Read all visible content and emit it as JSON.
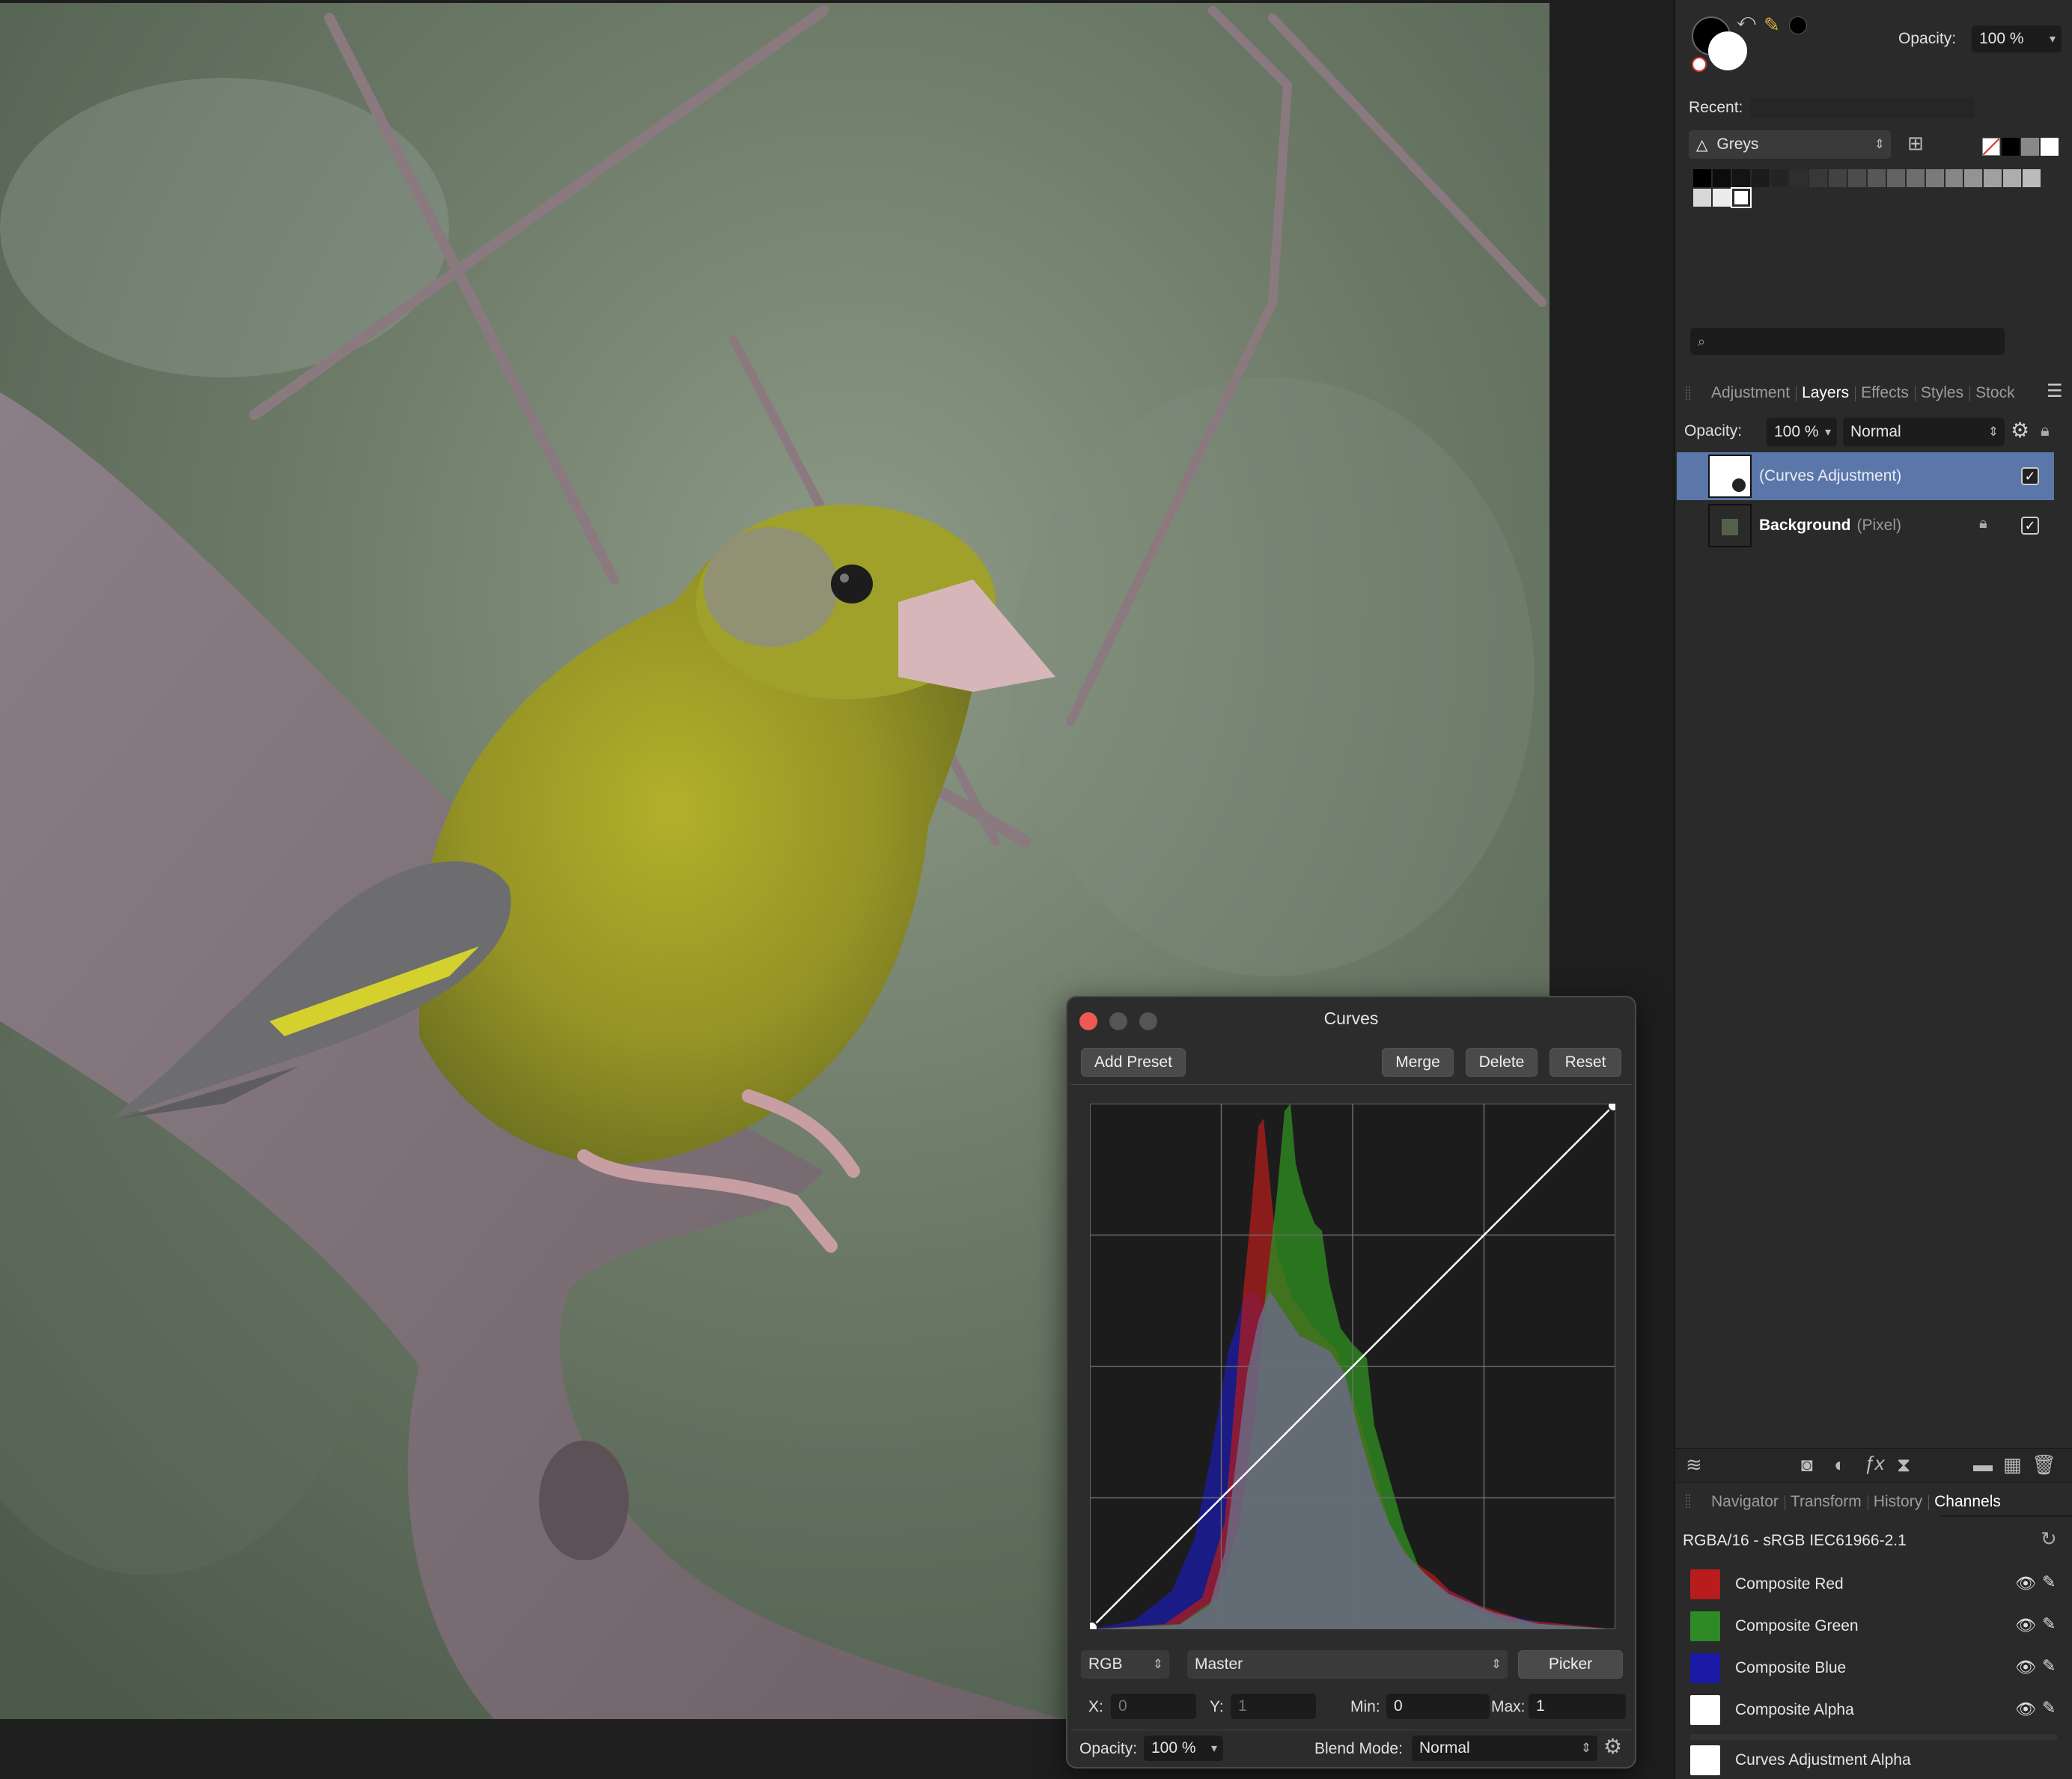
{
  "color_panel": {
    "opacity_label": "Opacity:",
    "opacity_value": "100 %",
    "recent_label": "Recent:",
    "palette_name": "Greys",
    "search_placeholder": ""
  },
  "layers_panel": {
    "tabs": [
      "Adjustment",
      "Layers",
      "Effects",
      "Styles",
      "Stock"
    ],
    "active_tab": "Layers",
    "opacity_label": "Opacity:",
    "opacity_value": "100 %",
    "blend_mode": "Normal",
    "layers": [
      {
        "name": "(Curves Adjustment)",
        "type": "",
        "selected": true,
        "visible": true,
        "locked": false
      },
      {
        "name": "Background",
        "type": "(Pixel)",
        "selected": false,
        "visible": true,
        "locked": true
      }
    ]
  },
  "channels_panel": {
    "tabs": [
      "Navigator",
      "Transform",
      "History",
      "Channels"
    ],
    "active_tab": "Channels",
    "format": "RGBA/16 - sRGB IEC61966-2.1",
    "channels": [
      {
        "name": "Composite Red",
        "color": "#b81c1c"
      },
      {
        "name": "Composite Green",
        "color": "#2e8a24"
      },
      {
        "name": "Composite Blue",
        "color": "#1a1aa6"
      },
      {
        "name": "Composite Alpha",
        "color": "#ffffff"
      },
      {
        "name": "Curves Adjustment Alpha",
        "color": "#ffffff"
      }
    ]
  },
  "curves_dialog": {
    "title": "Curves",
    "add_preset": "Add Preset",
    "merge": "Merge",
    "delete": "Delete",
    "reset": "Reset",
    "color_space": "RGB",
    "channel": "Master",
    "picker": "Picker",
    "x_label": "X:",
    "x_value": "0",
    "y_label": "Y:",
    "y_value": "1",
    "min_label": "Min:",
    "min_value": "0",
    "max_label": "Max:",
    "max_value": "1",
    "opacity_label": "Opacity:",
    "opacity_value": "100 %",
    "blend_mode_label": "Blend Mode:",
    "blend_mode_value": "Normal"
  },
  "colors": {
    "selection": "#5b76a8",
    "close": "#ee5a52"
  }
}
